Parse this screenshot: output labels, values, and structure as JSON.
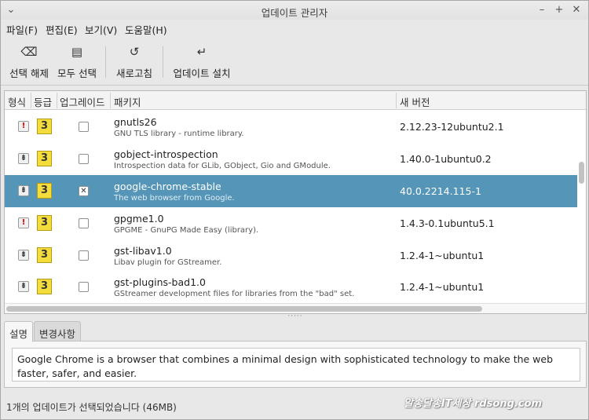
{
  "window": {
    "title": "업데이트 관리자"
  },
  "menu": [
    "파일(F)",
    "편집(E)",
    "보기(V)",
    "도움말(H)"
  ],
  "toolbar": {
    "clear": "선택 해제",
    "select_all": "모두 선택",
    "refresh": "새로고침",
    "install": "업데이트 설치"
  },
  "columns": {
    "type": "형식",
    "grade": "등급",
    "upgrade": "업그레이드",
    "package": "패키지",
    "new_version": "새 버전"
  },
  "packages": [
    {
      "name": "gnutls26",
      "desc": "GNU TLS library - runtime library.",
      "version": "2.12.23-12ubuntu2.1",
      "type": "security",
      "type_icon": "!",
      "grade": "3",
      "checked": ""
    },
    {
      "name": "gobject-introspection",
      "desc": "Introspection data for GLib, GObject, Gio and GModule.",
      "version": "1.40.0-1ubuntu0.2",
      "type": "package",
      "type_icon": "⇟",
      "grade": "3",
      "checked": ""
    },
    {
      "name": "google-chrome-stable",
      "desc": "The web browser from Google.",
      "version": "40.0.2214.115-1",
      "type": "package",
      "type_icon": "⇟",
      "grade": "3",
      "checked": "✕"
    },
    {
      "name": "gpgme1.0",
      "desc": "GPGME - GnuPG Made Easy (library).",
      "version": "1.4.3-0.1ubuntu5.1",
      "type": "security",
      "type_icon": "!",
      "grade": "3",
      "checked": ""
    },
    {
      "name": "gst-libav1.0",
      "desc": "Libav plugin for GStreamer.",
      "version": "1.2.4-1~ubuntu1",
      "type": "package",
      "type_icon": "⇟",
      "grade": "3",
      "checked": ""
    },
    {
      "name": "gst-plugins-bad1.0",
      "desc": "GStreamer development files for libraries from the \"bad\" set.",
      "version": "1.2.4-1~ubuntu1",
      "type": "package",
      "type_icon": "⇟",
      "grade": "3",
      "checked": ""
    }
  ],
  "tabs": {
    "description": "설명",
    "changes": "변경사항"
  },
  "description_text": "Google Chrome is a browser that combines a minimal design with sophisticated technology to make the web faster, safer, and easier.",
  "status": "1개의 업데이트가 선택되었습니다 (46MB)",
  "watermark": "알송달송IT세상 rdsong.com"
}
